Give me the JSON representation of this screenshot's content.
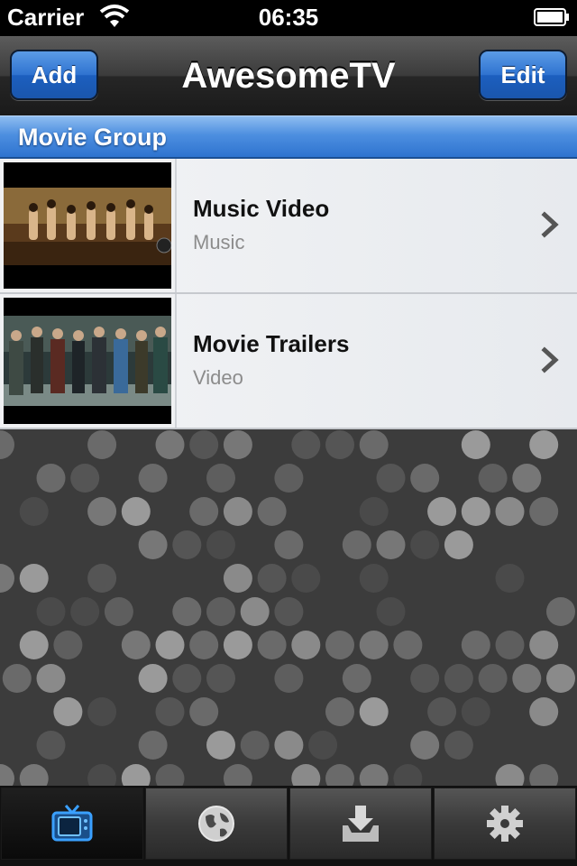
{
  "status_bar": {
    "carrier": "Carrier",
    "time": "06:35"
  },
  "nav_bar": {
    "title": "AwesomeTV",
    "add_label": "Add",
    "edit_label": "Edit"
  },
  "section": {
    "title": "Movie Group"
  },
  "rows": [
    {
      "title": "Music Video",
      "subtitle": "Music"
    },
    {
      "title": "Movie Trailers",
      "subtitle": "Video"
    }
  ],
  "tabs": [
    {
      "icon": "tv-icon",
      "active": true
    },
    {
      "icon": "globe-icon",
      "active": false
    },
    {
      "icon": "download-tray-icon",
      "active": false
    },
    {
      "icon": "gear-icon",
      "active": false
    }
  ],
  "colors": {
    "accent": "#2f73d0",
    "tab_active": "#3aa0ff"
  }
}
